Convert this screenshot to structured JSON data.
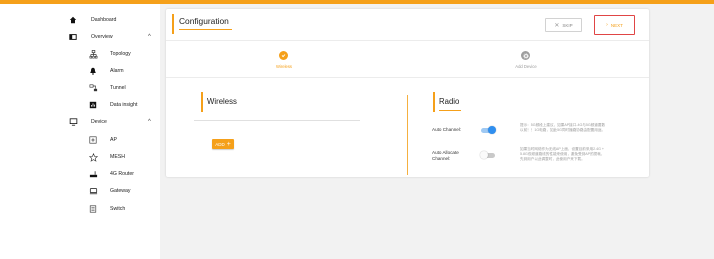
{
  "sidebar": {
    "items": [
      {
        "label": "Dashboard",
        "icon": "home-icon"
      },
      {
        "label": "Overview",
        "icon": "overview-icon",
        "chevron": "^"
      },
      {
        "label": "Topology",
        "icon": "topology-icon"
      },
      {
        "label": "Alarm",
        "icon": "bell-icon"
      },
      {
        "label": "Tunnel",
        "icon": "tunnel-icon"
      },
      {
        "label": "Data insight",
        "icon": "data-insight-icon"
      },
      {
        "label": "Device",
        "icon": "monitor-icon",
        "chevron": "^"
      },
      {
        "label": "AP",
        "icon": "ap-icon"
      },
      {
        "label": "MESH",
        "icon": "mesh-icon"
      },
      {
        "label": "4G Router",
        "icon": "router-icon"
      },
      {
        "label": "Gateway",
        "icon": "gateway-icon"
      },
      {
        "label": "Switch",
        "icon": "switch-icon"
      }
    ]
  },
  "header": {
    "title": "Configuration",
    "skip_label": "SKIP",
    "next_label": "NEXT"
  },
  "steps": [
    {
      "label": "Wireless",
      "state": "active"
    },
    {
      "label": "Add Device",
      "state": "pending"
    }
  ],
  "wireless": {
    "title": "Wireless",
    "add_label": "ADD"
  },
  "radio": {
    "title": "Radio",
    "auto_channel_label": "Auto Channel:",
    "auto_channel_on": true,
    "auto_allocate_label": "Auto Allocate Channel:",
    "auto_allocate_on": false,
    "note1": "提示：5G频段上建议，如果AP接口-4G与5G频道要数以前！！1G电路，如此5G同时播路协路由配置用途。",
    "note2": "如果当时网络作为无线AP上面，设置目前采用2.4G + 5.8G双频道路线的性能来使用，避免受到AP的损耗，先到用户以此调整时，此使用户来下载。"
  },
  "colors": {
    "accent": "#f5a01a",
    "toggle_on": "#2f8ff0"
  }
}
